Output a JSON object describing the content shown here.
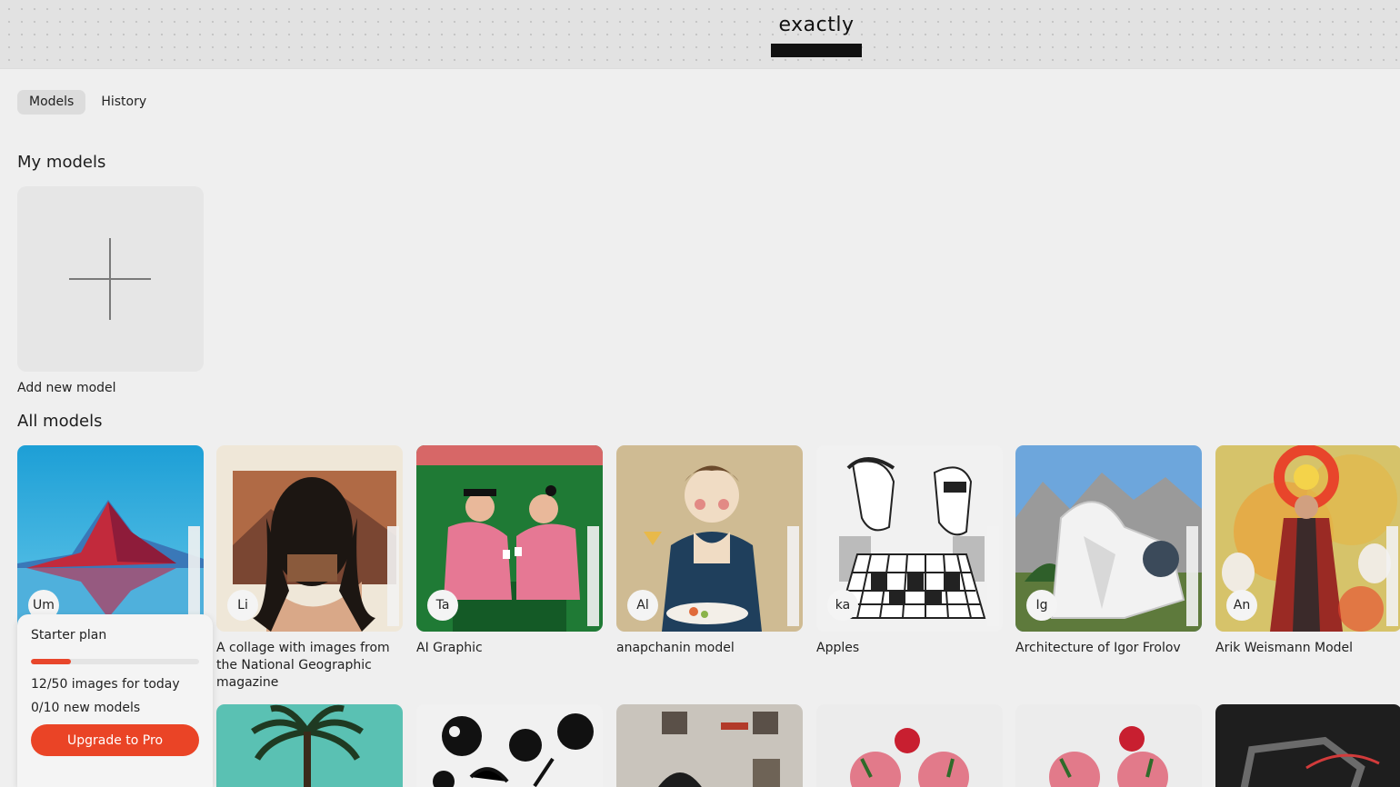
{
  "brand": {
    "logo_text": "exactly"
  },
  "tabs": [
    {
      "label": "Models",
      "active": true
    },
    {
      "label": "History",
      "active": false
    }
  ],
  "my_models": {
    "title": "My models",
    "add_label": "Add new model"
  },
  "all_models": {
    "title": "All models",
    "items": [
      {
        "initials": "Um",
        "title": ""
      },
      {
        "initials": "Li",
        "title": "A collage with images from the National Geographic magazine"
      },
      {
        "initials": "Ta",
        "title": "AI Graphic"
      },
      {
        "initials": "Al",
        "title": "anapchanin model"
      },
      {
        "initials": "ka",
        "title": "Apples"
      },
      {
        "initials": "Ig",
        "title": "Architecture of Igor Frolov"
      },
      {
        "initials": "An",
        "title": "Arik Weismann Model"
      }
    ]
  },
  "plan": {
    "title": "Starter plan",
    "progress": 0.24,
    "images_text": "12/50 images for today",
    "models_text": "0/10 new models",
    "upgrade_label": "Upgrade to Pro"
  },
  "colors": {
    "accent": "#ea4426",
    "background": "#efefef"
  }
}
